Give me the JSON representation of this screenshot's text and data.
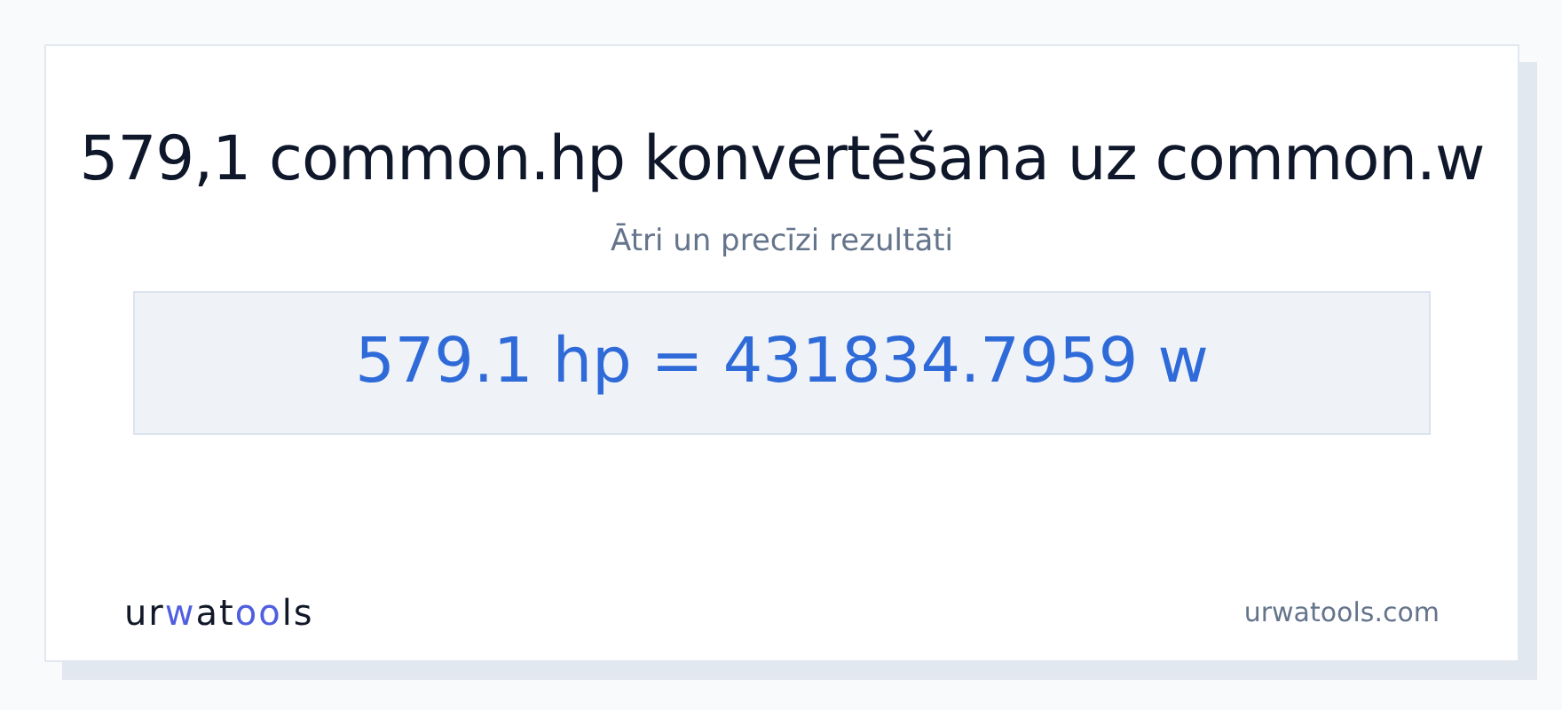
{
  "title": "579,1 common.hp konvertēšana uz common.w",
  "subtitle": "Ātri un precīzi rezultāti",
  "result": "579.1 hp = 431834.7959 w",
  "footer": {
    "logo": [
      {
        "text": "ur",
        "accent": false
      },
      {
        "text": "w",
        "accent": true
      },
      {
        "text": "at",
        "accent": false
      },
      {
        "text": "oo",
        "accent": true
      },
      {
        "text": "ls",
        "accent": false
      }
    ],
    "site": "urwatools.com"
  }
}
